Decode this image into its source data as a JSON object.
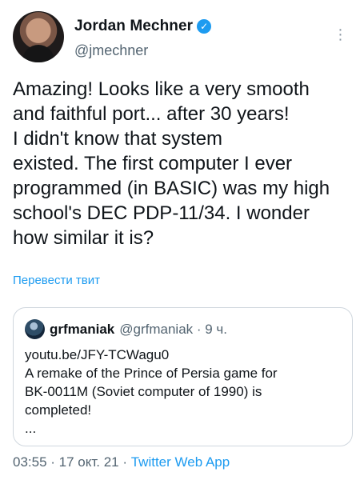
{
  "author": {
    "display_name": "Jordan Mechner",
    "handle": "@jmechner"
  },
  "more_menu": {
    "label": "⋮"
  },
  "tweet": {
    "text": "Amazing! Looks like a very smooth\nand faithful port... after 30 years!\nI didn't know that system\nexisted. The first computer I ever\nprogrammed (in BASIC) was my high\nschool's DEC PDP-11/34. I wonder\nhow similar it is?",
    "translate_label": "Перевести твит"
  },
  "quoted_tweet": {
    "display_name": "grfmaniak",
    "meta": "@grfmaniak · 9 ч.",
    "text": "youtu.be/JFY-TCWagu0\nA remake of the Prince of Persia game for\nBK-0011M (Soviet computer of 1990) is\ncompleted!\n..."
  },
  "footer": {
    "time_date": "03:55 · 17 окт. 21 · ",
    "source": "Twitter Web App"
  },
  "colors": {
    "accent": "#1d9bf0",
    "secondary_text": "#536471",
    "border": "#d0d7de"
  }
}
